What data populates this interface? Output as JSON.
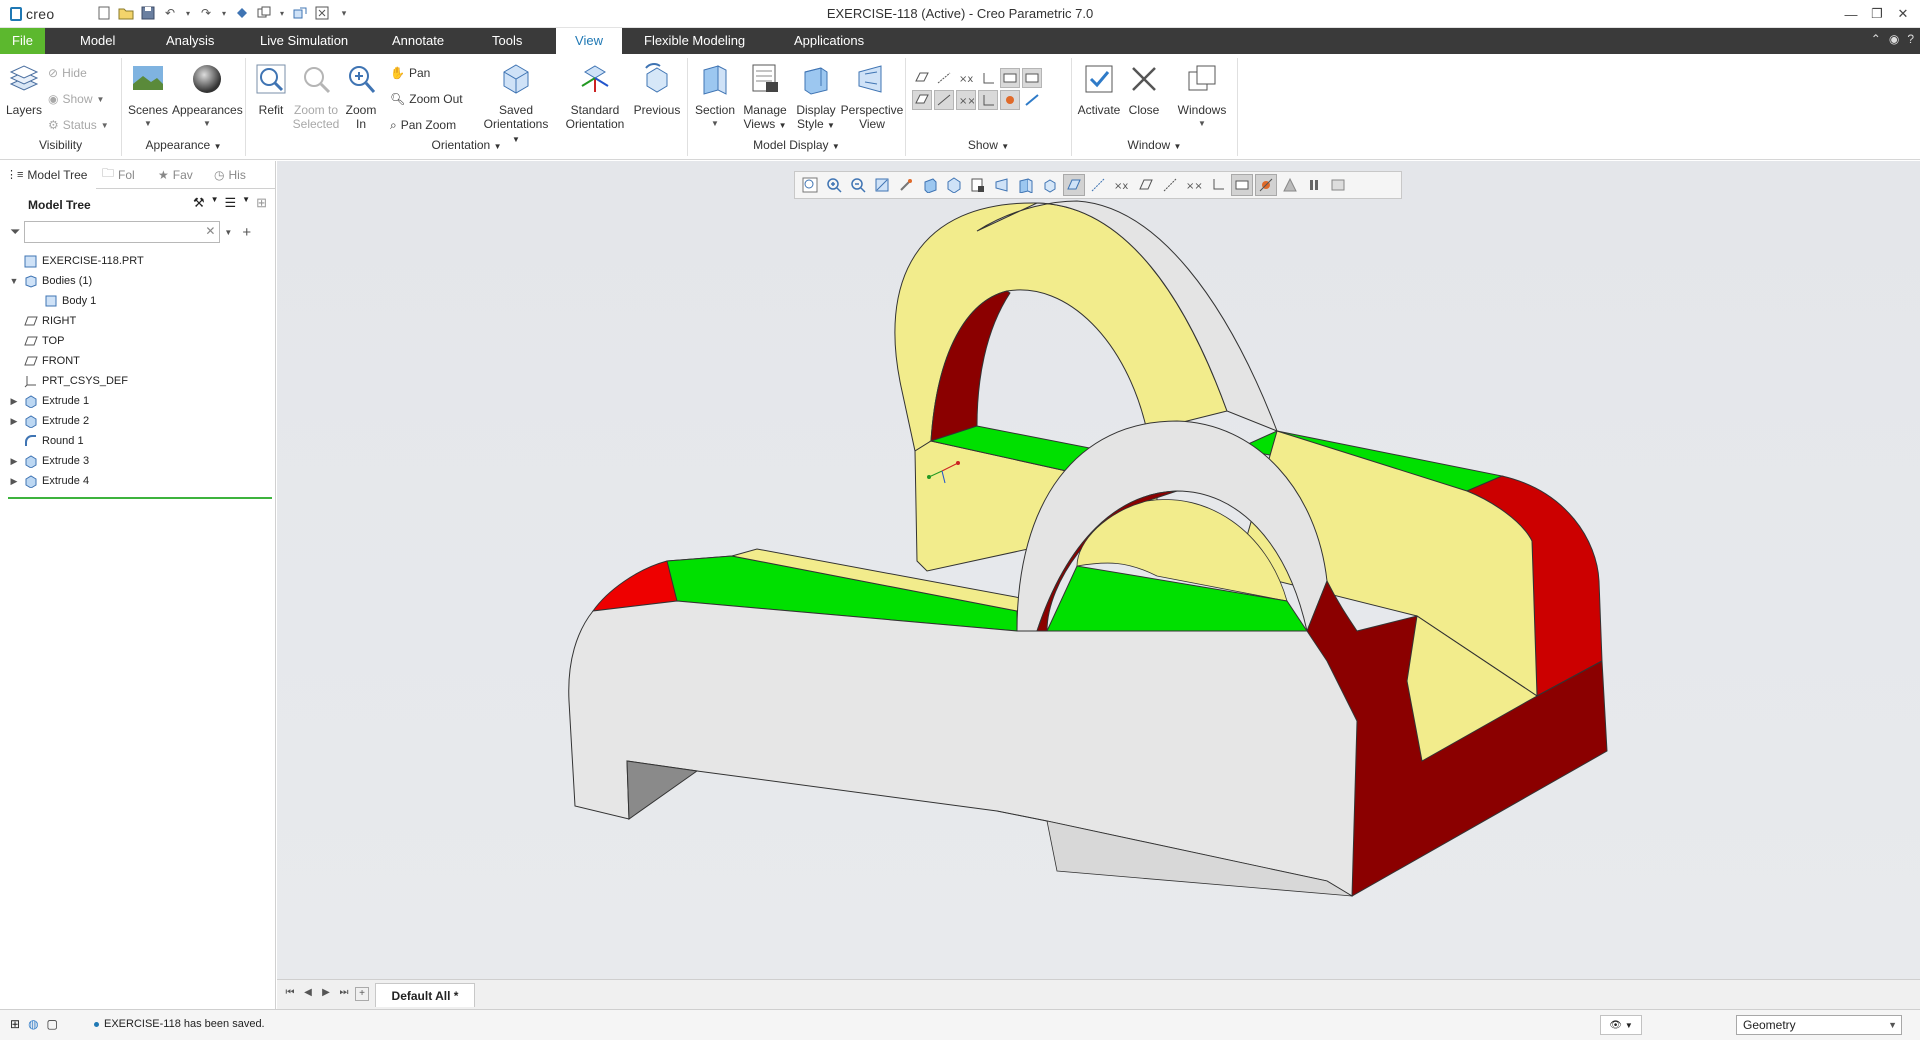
{
  "app": {
    "logo": "creo",
    "window_title": "EXERCISE-118 (Active) - Creo Parametric 7.0"
  },
  "menu": {
    "tabs": [
      "File",
      "Model",
      "Analysis",
      "Live Simulation",
      "Annotate",
      "Tools",
      "View",
      "Flexible Modeling",
      "Applications"
    ],
    "active_tab": "View"
  },
  "ribbon": {
    "visibility": {
      "label": "Visibility",
      "layers": "Layers",
      "hide": "Hide",
      "show": "Show",
      "status": "Status"
    },
    "appearance": {
      "label": "Appearance",
      "scenes": "Scenes",
      "appearances": "Appearances"
    },
    "orientation": {
      "label": "Orientation",
      "refit": "Refit",
      "zoom_to_selected_1": "Zoom to",
      "zoom_to_selected_2": "Selected",
      "zoom_in_1": "Zoom",
      "zoom_in_2": "In",
      "pan": "Pan",
      "zoom_out": "Zoom Out",
      "pan_zoom": "Pan Zoom",
      "saved_orientations_1": "Saved",
      "saved_orientations_2": "Orientations",
      "standard_orientation_1": "Standard",
      "standard_orientation_2": "Orientation",
      "previous": "Previous"
    },
    "model_display": {
      "label": "Model Display",
      "section": "Section",
      "manage_views_1": "Manage",
      "manage_views_2": "Views",
      "display_style_1": "Display",
      "display_style_2": "Style",
      "perspective_view_1": "Perspective",
      "perspective_view_2": "View"
    },
    "show": {
      "label": "Show"
    },
    "window": {
      "label": "Window",
      "activate": "Activate",
      "close": "Close",
      "windows": "Windows"
    }
  },
  "left_panel": {
    "tabs": [
      "Model Tree",
      "Folder Browser",
      "Favorites",
      "History"
    ],
    "tab_visible": [
      "Model Tree",
      "Fol",
      "Fav",
      "His"
    ],
    "tree_title": "Model Tree",
    "search_placeholder": "",
    "tree_items": [
      {
        "label": "EXERCISE-118.PRT",
        "icon": "part-icon",
        "indent": 0,
        "expander": ""
      },
      {
        "label": "Bodies (1)",
        "icon": "bodies-icon",
        "indent": 0,
        "expander": "expanded"
      },
      {
        "label": "Body 1",
        "icon": "body-icon",
        "indent": 1,
        "expander": ""
      },
      {
        "label": "RIGHT",
        "icon": "datum-plane-icon",
        "indent": 0,
        "expander": ""
      },
      {
        "label": "TOP",
        "icon": "datum-plane-icon",
        "indent": 0,
        "expander": ""
      },
      {
        "label": "FRONT",
        "icon": "datum-plane-icon",
        "indent": 0,
        "expander": ""
      },
      {
        "label": "PRT_CSYS_DEF",
        "icon": "csys-icon",
        "indent": 0,
        "expander": ""
      },
      {
        "label": "Extrude 1",
        "icon": "extrude-icon",
        "indent": 0,
        "expander": "collapsed"
      },
      {
        "label": "Extrude 2",
        "icon": "extrude-icon",
        "indent": 0,
        "expander": "collapsed"
      },
      {
        "label": "Round 1",
        "icon": "round-icon",
        "indent": 0,
        "expander": ""
      },
      {
        "label": "Extrude 3",
        "icon": "extrude-icon",
        "indent": 0,
        "expander": "collapsed"
      },
      {
        "label": "Extrude 4",
        "icon": "extrude-icon",
        "indent": 0,
        "expander": "collapsed"
      }
    ]
  },
  "graphics": {
    "colors": {
      "background": "#e6e8eb",
      "face_red": "#cc0000",
      "face_dark_red": "#8b0000",
      "face_green": "#00e000",
      "face_yellow": "#f2ec8c",
      "face_gray": "#e2e2e2"
    }
  },
  "window_tabs": {
    "active": "Default All *"
  },
  "status": {
    "message": "EXERCISE-118 has been saved.",
    "selection_filter": "Geometry"
  }
}
